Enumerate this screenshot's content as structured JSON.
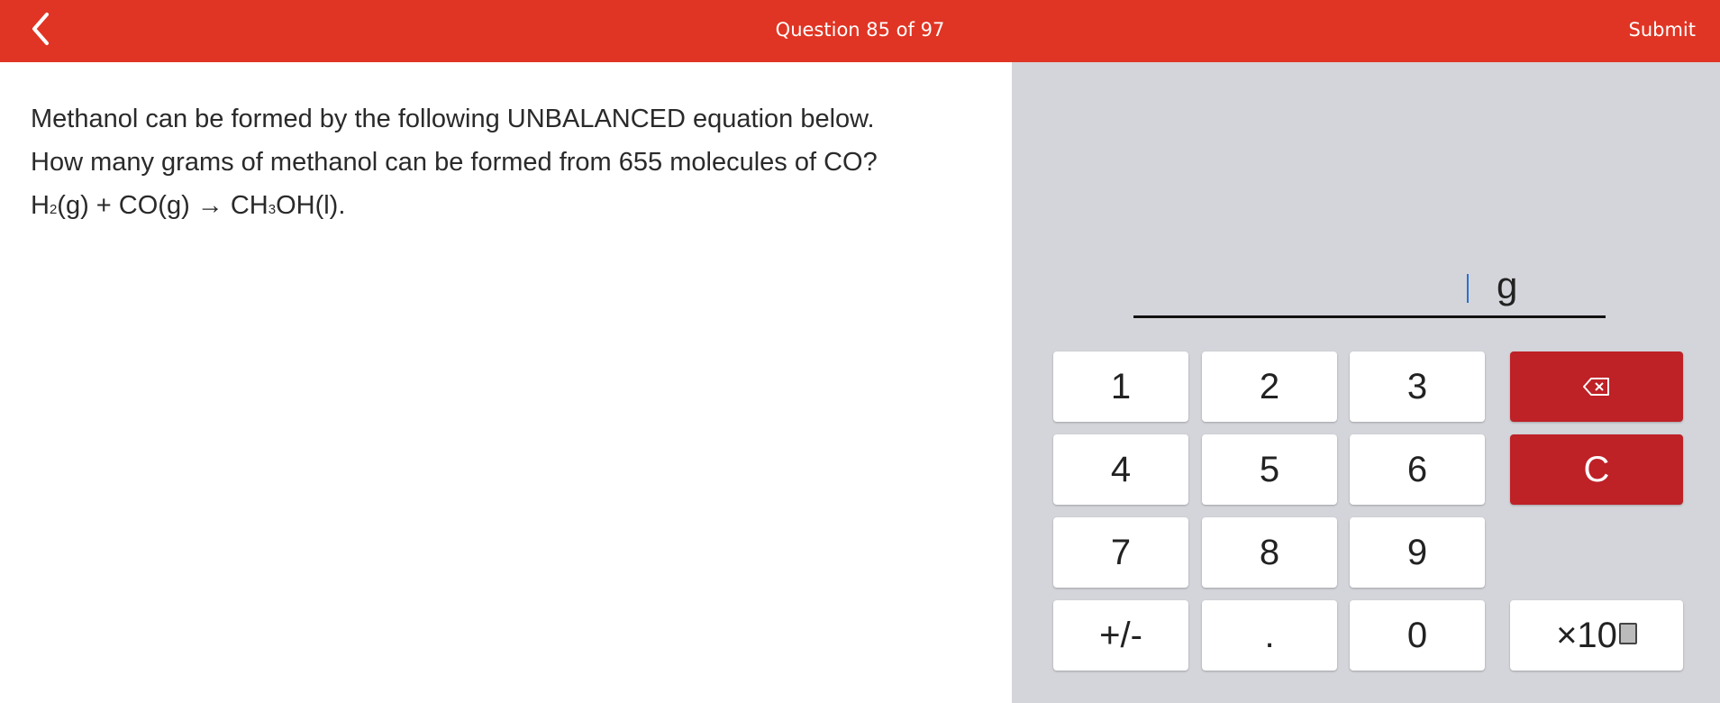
{
  "header": {
    "progress": "Question 85 of 97",
    "submit_label": "Submit",
    "back_icon": "chevron-left-icon"
  },
  "question": {
    "line1": "Methanol can be formed by the following UNBALANCED equation below.",
    "line2": "How many grams of methanol can be formed from 655 molecules of CO?",
    "equation": {
      "h": "H",
      "h_sub": "2",
      "part2": "(g) + CO(g) → CH",
      "ch_sub": "3",
      "part3": "OH(l)."
    }
  },
  "answer": {
    "value": "",
    "unit": "g"
  },
  "keypad": {
    "k1": "1",
    "k2": "2",
    "k3": "3",
    "k4": "4",
    "k5": "5",
    "k6": "6",
    "k7": "7",
    "k8": "8",
    "k9": "9",
    "sign": "+/-",
    "dot": ".",
    "k0": "0",
    "backspace_icon": "backspace-icon",
    "clear": "C",
    "times_ten": "×10"
  },
  "colors": {
    "header": "#e03524",
    "key_red": "#be2126",
    "panel": "#d4d5da"
  }
}
